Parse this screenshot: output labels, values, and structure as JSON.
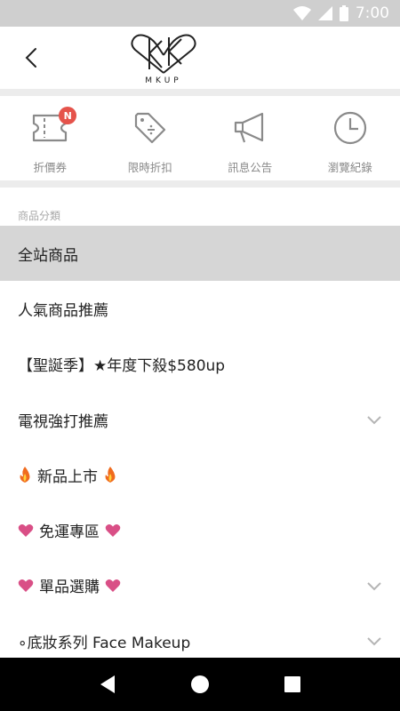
{
  "status_bar": {
    "time": "7:00"
  },
  "header": {
    "logo_text": "MKUP"
  },
  "quick_links": [
    {
      "label": "折價券",
      "badge": "N"
    },
    {
      "label": "限時折扣"
    },
    {
      "label": "訊息公告"
    },
    {
      "label": "瀏覽紀錄"
    }
  ],
  "section_title": "商品分類",
  "menu": {
    "items": [
      {
        "label": "全站商品"
      },
      {
        "label": "人氣商品推薦"
      },
      {
        "label": "【聖誕季】★年度下殺$580up"
      },
      {
        "label": "電視強打推薦"
      },
      {
        "label": "新品上市"
      },
      {
        "label": "免運專區"
      },
      {
        "label": "單品選購"
      },
      {
        "label": "∘底妝系列 Face Makeup"
      }
    ]
  },
  "colors": {
    "badge": "#e5534b",
    "heart": "#d94f86",
    "active_row": "#d6d6d6",
    "status_bar": "#cfcfcf"
  }
}
